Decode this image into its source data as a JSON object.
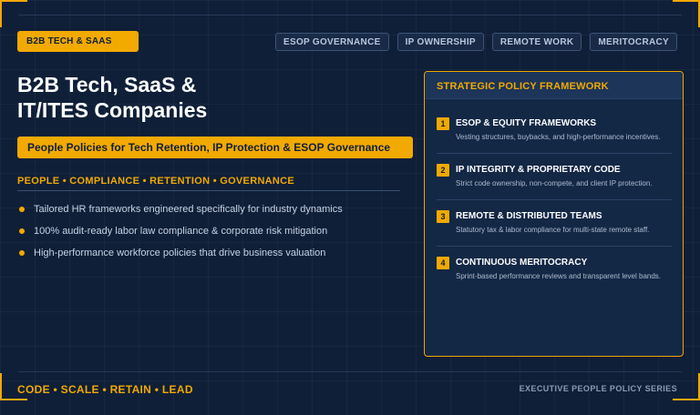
{
  "badge": "B2B TECH & SAAS",
  "tags": [
    "ESOP GOVERNANCE",
    "IP OWNERSHIP",
    "REMOTE WORK",
    "MERITOCRACY"
  ],
  "title": {
    "line1": "B2B Tech, SaaS &",
    "line2": "IT/ITES Companies"
  },
  "subtitle": "People Policies for Tech Retention, IP Protection & ESOP Governance",
  "pillars": "PEOPLE • COMPLIANCE • RETENTION • GOVERNANCE",
  "bullets": [
    "Tailored HR frameworks engineered specifically for industry dynamics",
    "100% audit-ready labor law compliance & corporate risk mitigation",
    "High-performance workforce policies that drive business valuation"
  ],
  "panel": {
    "header": "STRATEGIC POLICY FRAMEWORK",
    "items": [
      {
        "num": "1",
        "title": "ESOP & EQUITY FRAMEWORKS",
        "desc": "Vesting structures, buybacks, and high-performance incentives."
      },
      {
        "num": "2",
        "title": "IP INTEGRITY & PROPRIETARY CODE",
        "desc": "Strict code ownership, non-compete, and client IP protection."
      },
      {
        "num": "3",
        "title": "REMOTE & DISTRIBUTED TEAMS",
        "desc": "Statutory tax & labor compliance for multi-state remote staff."
      },
      {
        "num": "4",
        "title": "CONTINUOUS MERITOCRACY",
        "desc": "Sprint-based performance reviews and transparent level bands."
      }
    ]
  },
  "footer": {
    "left": "CODE • SCALE • RETAIN • LEAD",
    "right": "EXECUTIVE PEOPLE POLICY SERIES"
  },
  "colors": {
    "background": "#0f1f38",
    "accent": "#f2a900",
    "panel": "#132845"
  }
}
